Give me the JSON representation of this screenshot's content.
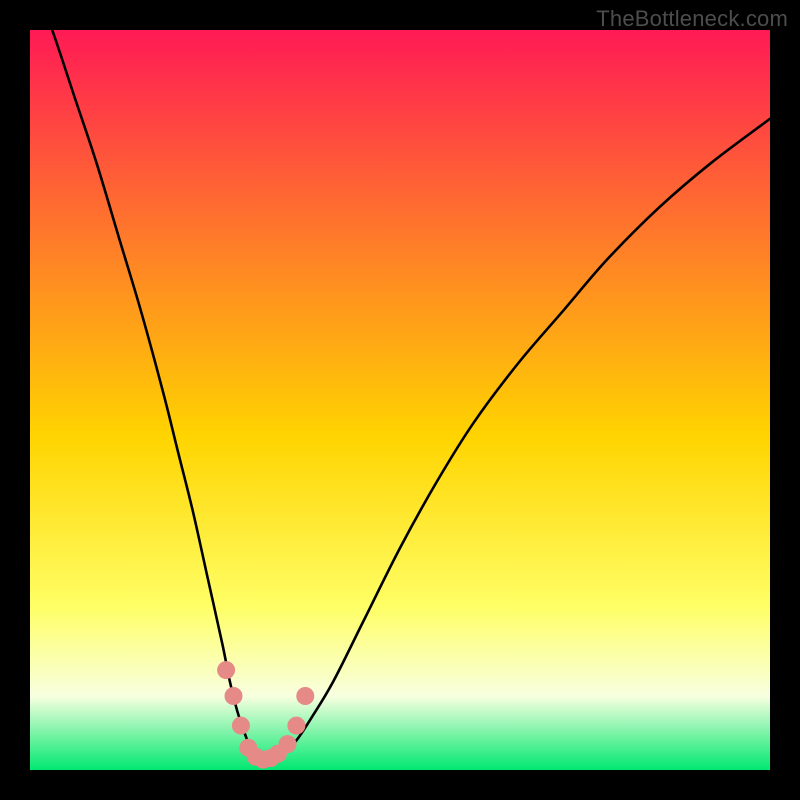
{
  "watermark": "TheBottleneck.com",
  "chart_data": {
    "type": "line",
    "title": "",
    "xlabel": "",
    "ylabel": "",
    "xlim": [
      0,
      100
    ],
    "ylim": [
      0,
      100
    ],
    "grid": false,
    "legend": false,
    "background_gradient": {
      "top": "#ff1a55",
      "mid1": "#ff7a2a",
      "mid2": "#ffd400",
      "mid3": "#ffff66",
      "mid4": "#f8ffe0",
      "bottom": "#00e870"
    },
    "series": [
      {
        "name": "bottleneck-curve",
        "color": "#000000",
        "x": [
          0,
          3,
          6,
          9,
          12,
          15,
          18,
          20,
          22,
          24,
          26,
          27,
          28,
          29,
          30,
          31,
          32,
          33,
          34,
          36,
          38,
          41,
          45,
          50,
          55,
          60,
          66,
          72,
          78,
          85,
          92,
          100
        ],
        "y": [
          108,
          100,
          91,
          82,
          72,
          62,
          51,
          43,
          35,
          26,
          17,
          12,
          8,
          5,
          2.5,
          1.5,
          1.3,
          1.5,
          2,
          4,
          7,
          12,
          20,
          30,
          39,
          47,
          55,
          62,
          69,
          76,
          82,
          88
        ]
      },
      {
        "name": "indicator-dots",
        "color": "#e58a86",
        "type": "scatter",
        "x": [
          26.5,
          27.5,
          28.5,
          29.5,
          30.5,
          31.5,
          32.5,
          33.5,
          34.8,
          36.0,
          37.2
        ],
        "y": [
          13.5,
          10.0,
          6.0,
          3.0,
          1.8,
          1.4,
          1.6,
          2.2,
          3.5,
          6.0,
          10.0
        ]
      }
    ]
  }
}
